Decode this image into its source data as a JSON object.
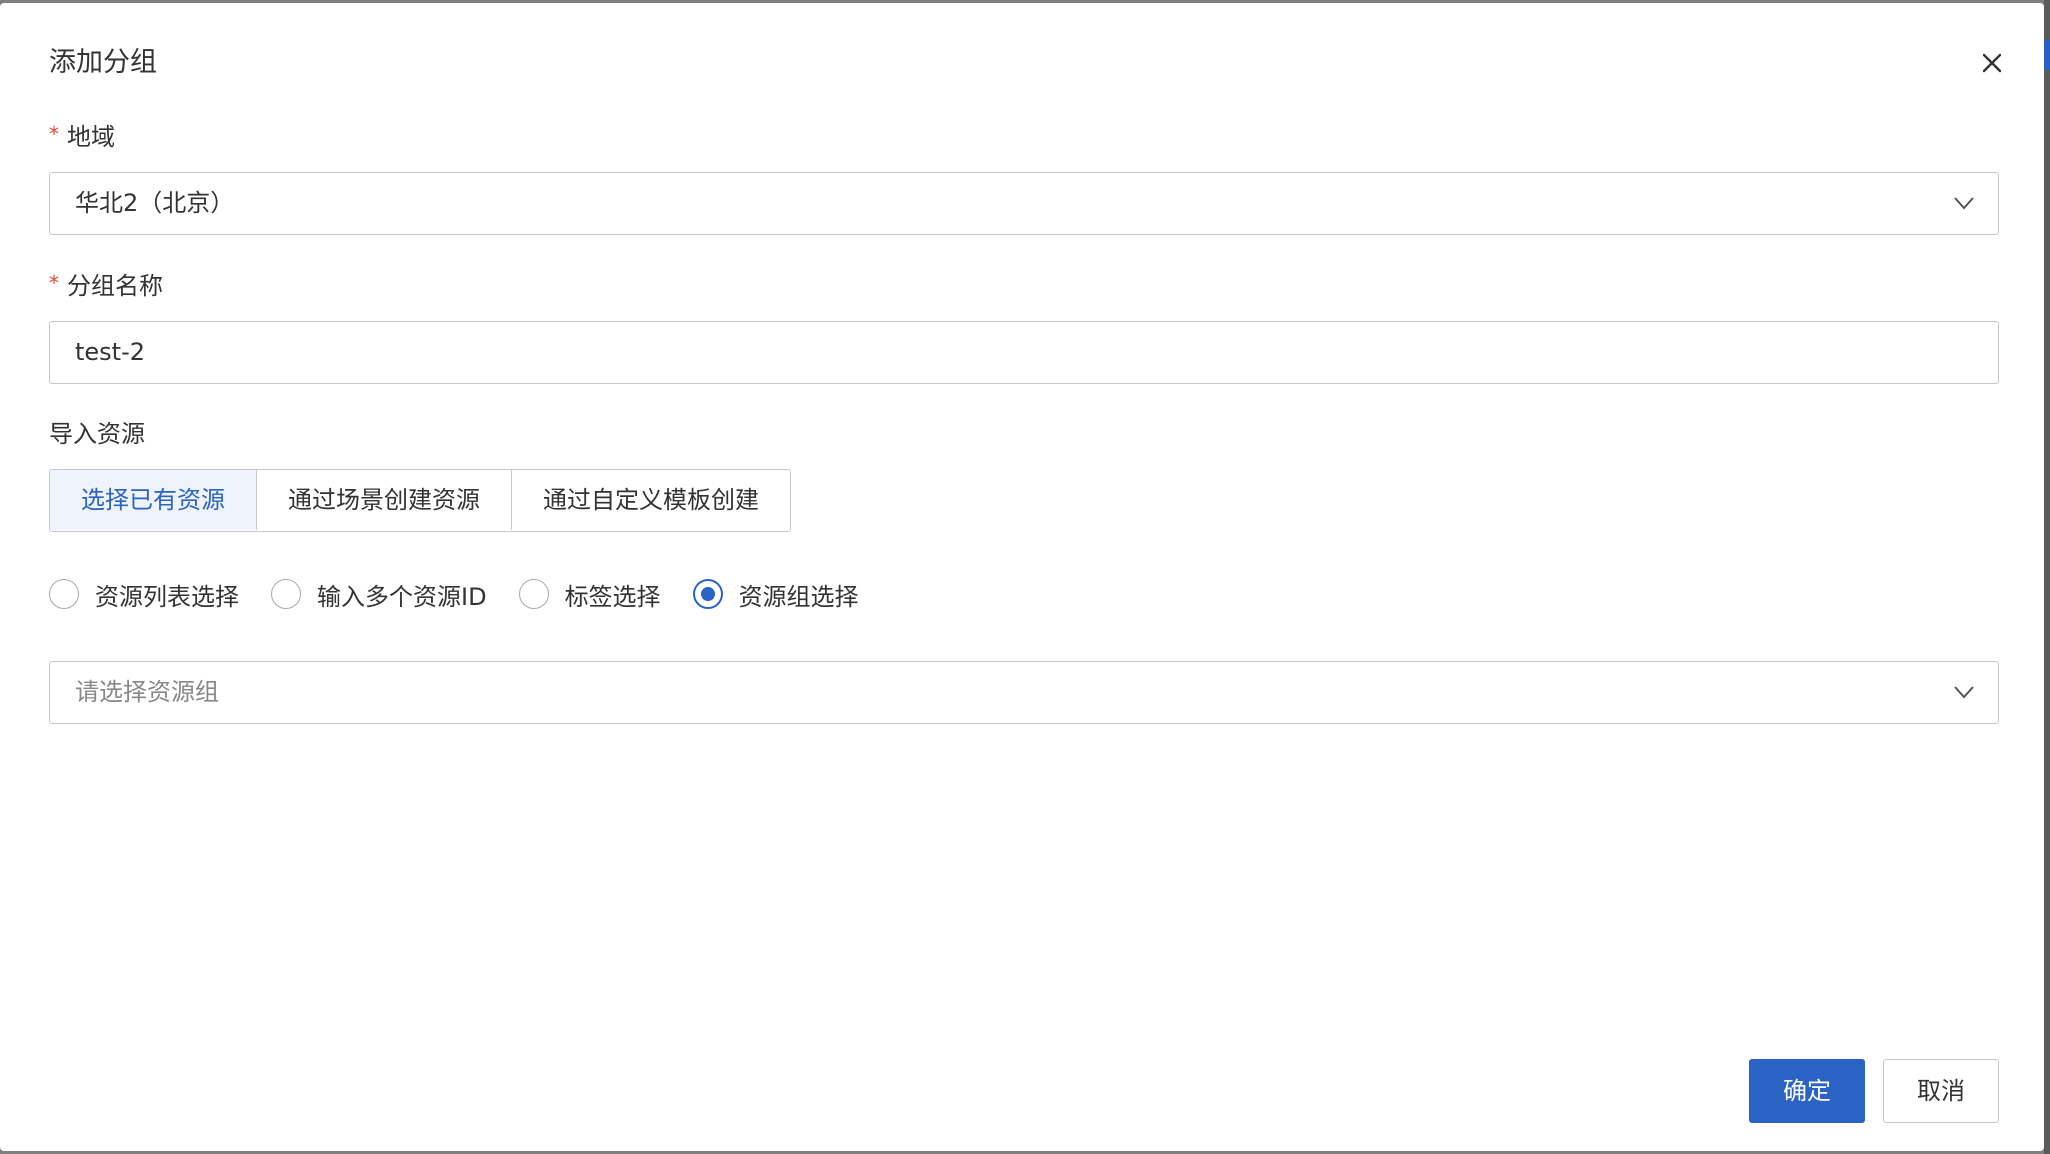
{
  "dialog": {
    "title": "添加分组"
  },
  "region": {
    "label": "地域",
    "required_mark": "*",
    "value": "华北2（北京）"
  },
  "group_name": {
    "label": "分组名称",
    "required_mark": "*",
    "value": "test-2"
  },
  "import_resources": {
    "label": "导入资源",
    "tabs": [
      {
        "label": "选择已有资源",
        "active": true
      },
      {
        "label": "通过场景创建资源",
        "active": false
      },
      {
        "label": "通过自定义模板创建",
        "active": false
      }
    ],
    "radio_options": [
      {
        "label": "资源列表选择",
        "checked": false
      },
      {
        "label": "输入多个资源ID",
        "checked": false
      },
      {
        "label": "标签选择",
        "checked": false
      },
      {
        "label": "资源组选择",
        "checked": true
      }
    ],
    "resource_group_select": {
      "placeholder": "请选择资源组"
    }
  },
  "footer": {
    "confirm_label": "确定",
    "cancel_label": "取消"
  },
  "colors": {
    "primary": "#2a63c4",
    "required": "#e0463a",
    "border": "#c8c8c8",
    "active_tab_bg": "#eef3fc"
  },
  "icons": {
    "close": "close-icon",
    "dropdown": "chevron-down-icon"
  }
}
